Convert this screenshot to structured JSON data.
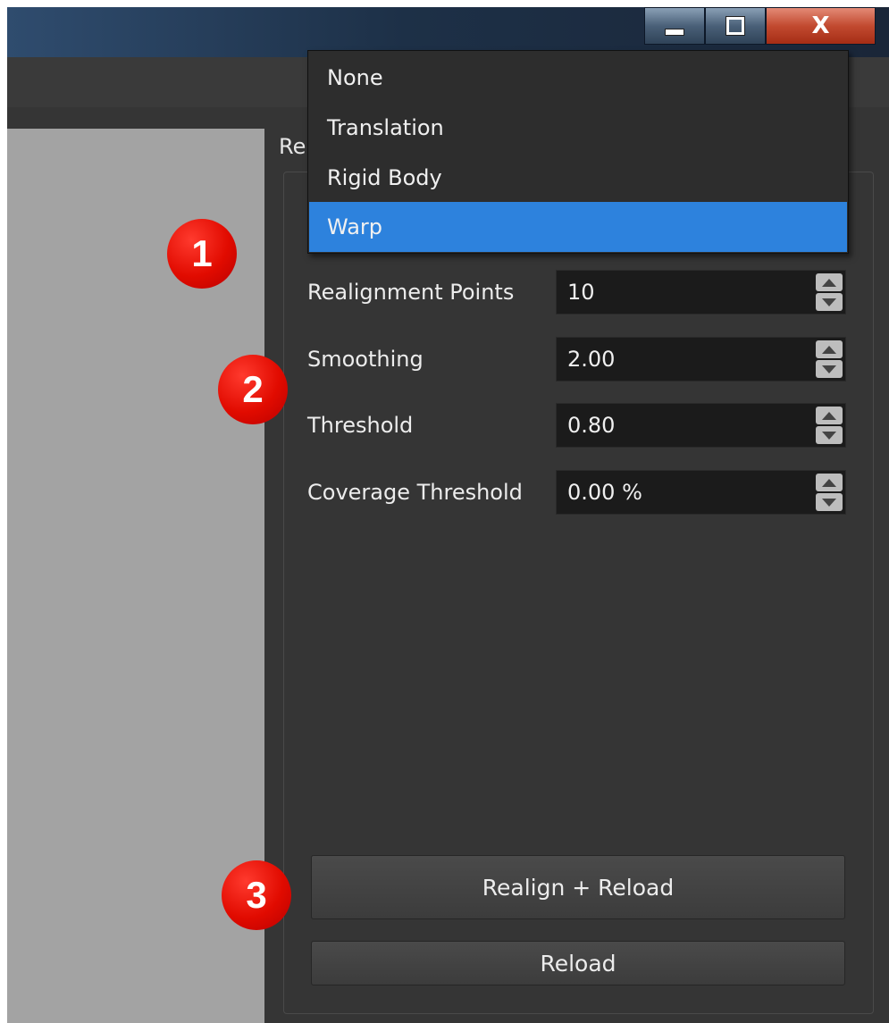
{
  "window": {
    "minimize_label": "",
    "maximize_label": "",
    "close_label": "X"
  },
  "realign": {
    "group_title": "Re",
    "dropdown": {
      "options": [
        "None",
        "Translation",
        "Rigid Body",
        "Warp"
      ],
      "selected": "Warp"
    },
    "fields": [
      {
        "label": "Realignment Points",
        "value": "10"
      },
      {
        "label": "Smoothing",
        "value": "2.00"
      },
      {
        "label": "Threshold",
        "value": "0.80"
      },
      {
        "label": "Coverage Threshold",
        "value": "0.00 %"
      }
    ],
    "buttons": {
      "realign_reload": "Realign + Reload",
      "reload": "Reload"
    }
  },
  "annotations": [
    "1",
    "2",
    "3"
  ]
}
